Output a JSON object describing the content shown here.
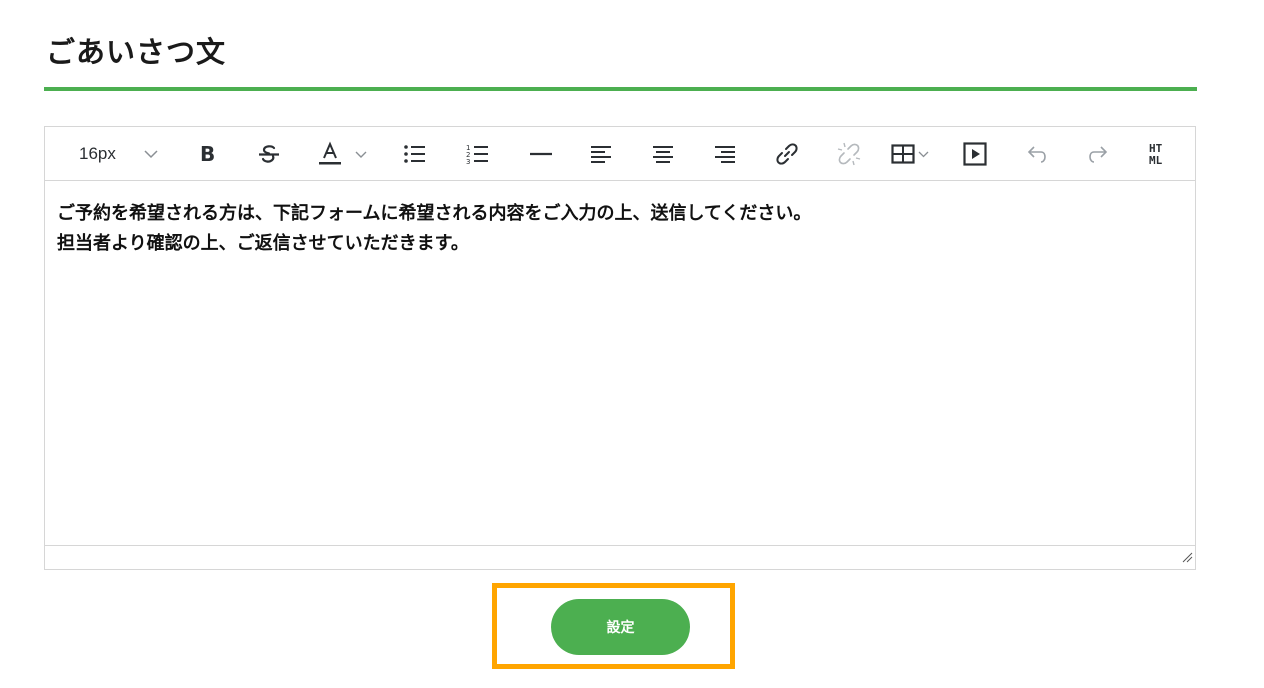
{
  "page": {
    "title": "ごあいさつ文",
    "accent_color": "#4caf50",
    "highlight_color": "#ffa500"
  },
  "toolbar": {
    "font_size": "16px",
    "items": [
      {
        "name": "font-size-select",
        "icon": "chevron-down-icon"
      },
      {
        "name": "bold-button",
        "icon": "bold-icon"
      },
      {
        "name": "strikethrough-button",
        "icon": "strikethrough-icon"
      },
      {
        "name": "text-color-button",
        "icon": "text-color-icon"
      },
      {
        "name": "bullet-list-button",
        "icon": "bullet-list-icon"
      },
      {
        "name": "numbered-list-button",
        "icon": "numbered-list-icon"
      },
      {
        "name": "horizontal-rule-button",
        "icon": "horizontal-rule-icon"
      },
      {
        "name": "align-left-button",
        "icon": "align-left-icon"
      },
      {
        "name": "align-center-button",
        "icon": "align-center-icon"
      },
      {
        "name": "align-right-button",
        "icon": "align-right-icon"
      },
      {
        "name": "link-button",
        "icon": "link-icon"
      },
      {
        "name": "unlink-button",
        "icon": "unlink-icon"
      },
      {
        "name": "table-button",
        "icon": "table-icon"
      },
      {
        "name": "video-button",
        "icon": "play-icon"
      },
      {
        "name": "undo-button",
        "icon": "undo-icon"
      },
      {
        "name": "redo-button",
        "icon": "redo-icon"
      },
      {
        "name": "html-button",
        "icon": "html-icon",
        "label": "HT ML"
      }
    ]
  },
  "editor": {
    "lines": [
      "ご予約を希望される方は、下記フォームに希望される内容をご入力の上、送信してください。",
      "担当者より確認の上、ご返信させていただきます。"
    ]
  },
  "submit": {
    "label": "設定"
  }
}
